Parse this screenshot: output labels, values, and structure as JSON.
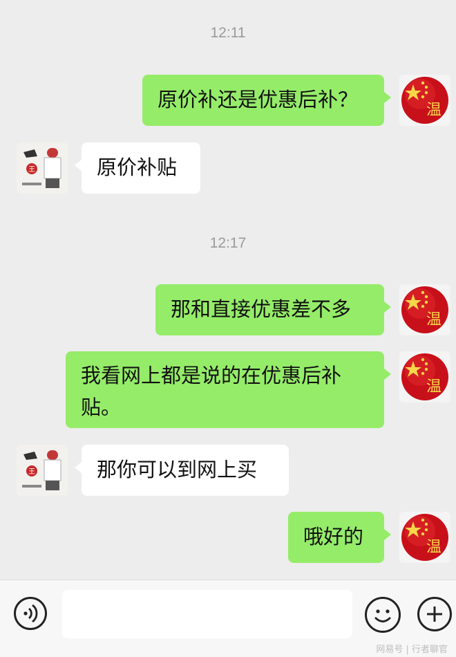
{
  "chat": {
    "timestamps": [
      "12:11",
      "12:17"
    ],
    "messages": [
      {
        "sender": "me",
        "text": "原价补还是优惠后补？"
      },
      {
        "sender": "other",
        "text": "原价补贴"
      },
      {
        "sender": "me",
        "text": "那和直接优惠差不多"
      },
      {
        "sender": "me",
        "text": "我看网上都是说的在优惠后补",
        "text2": "贴。"
      },
      {
        "sender": "other",
        "text": "那你可以到网上买"
      },
      {
        "sender": "me",
        "text": "哦好的"
      }
    ],
    "my_avatar": {
      "char": "温",
      "sub": "文字图片",
      "colors": {
        "ball": "#c8101b",
        "star": "#f7d64a"
      }
    },
    "other_avatar": {
      "badge_char": "王",
      "colors": {
        "badge": "#c62828"
      }
    }
  },
  "input_bar": {
    "voice_icon": "voice-icon",
    "emoji_icon": "emoji-icon",
    "plus_icon": "plus-icon",
    "input_value": ""
  },
  "watermark": "网易号 | 行者聊官",
  "colors": {
    "out_bubble": "#95ec69",
    "in_bubble": "#ffffff",
    "background": "#ededed"
  }
}
